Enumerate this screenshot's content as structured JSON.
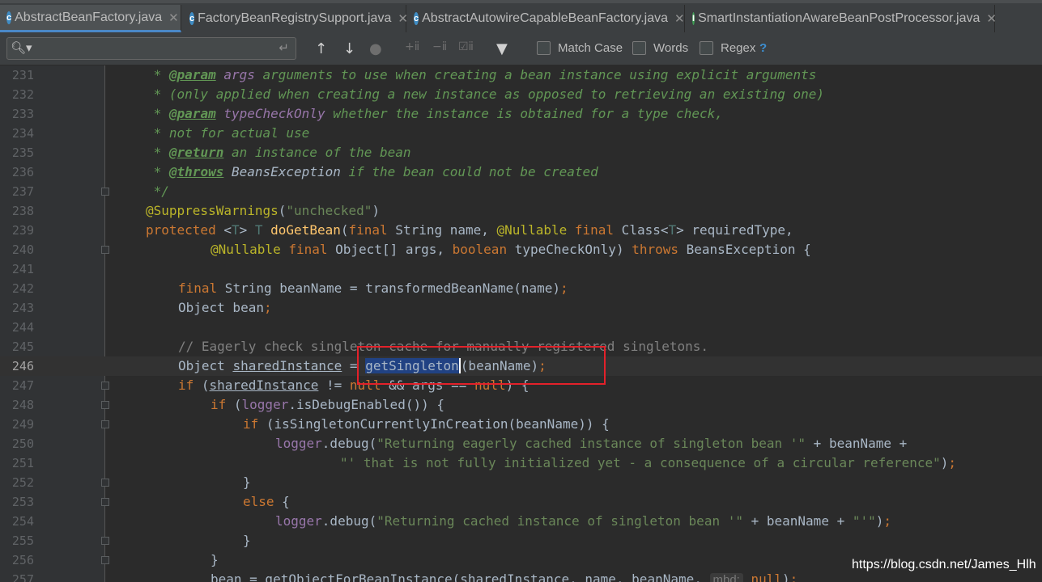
{
  "tabs": [
    {
      "label": "AbstractBeanFactory.java",
      "active": true,
      "icon": "java-class-icon",
      "icon_glyph": "c"
    },
    {
      "label": "FactoryBeanRegistrySupport.java",
      "active": false,
      "icon": "java-class-icon",
      "icon_glyph": "c"
    },
    {
      "label": "AbstractAutowireCapableBeanFactory.java",
      "active": false,
      "icon": "java-class-icon",
      "icon_glyph": "c"
    },
    {
      "label": "SmartInstantiationAwareBeanPostProcessor.java",
      "active": false,
      "icon": "java-interface-icon",
      "icon_glyph": "I"
    }
  ],
  "search": {
    "value": "",
    "options": {
      "match_case": "Match Case",
      "words": "Words",
      "regex": "Regex"
    },
    "help": "?"
  },
  "code_lines": [
    {
      "n": "231",
      "fold": false
    },
    {
      "n": "232",
      "fold": false
    },
    {
      "n": "233",
      "fold": false
    },
    {
      "n": "234",
      "fold": false
    },
    {
      "n": "235",
      "fold": false
    },
    {
      "n": "236",
      "fold": false
    },
    {
      "n": "237",
      "fold": true
    },
    {
      "n": "238",
      "fold": false
    },
    {
      "n": "239",
      "fold": false
    },
    {
      "n": "240",
      "fold": true
    },
    {
      "n": "241",
      "fold": false
    },
    {
      "n": "242",
      "fold": false
    },
    {
      "n": "243",
      "fold": false
    },
    {
      "n": "244",
      "fold": false
    },
    {
      "n": "245",
      "fold": false
    },
    {
      "n": "246",
      "fold": false,
      "current": true
    },
    {
      "n": "247",
      "fold": true
    },
    {
      "n": "248",
      "fold": true
    },
    {
      "n": "249",
      "fold": true
    },
    {
      "n": "250",
      "fold": false
    },
    {
      "n": "251",
      "fold": false
    },
    {
      "n": "252",
      "fold": true
    },
    {
      "n": "253",
      "fold": true
    },
    {
      "n": "254",
      "fold": false
    },
    {
      "n": "255",
      "fold": true
    },
    {
      "n": "256",
      "fold": true
    },
    {
      "n": "257",
      "fold": false
    }
  ],
  "code": {
    "l231": {
      "star": " * ",
      "tag": "@param",
      "name": "args",
      "text": " arguments to use when creating a bean instance using explicit arguments"
    },
    "l232": {
      "text": " * (only applied when creating a new instance as opposed to retrieving an existing one)"
    },
    "l233": {
      "star": " * ",
      "tag": "@param",
      "name": "typeCheckOnly",
      "text": " whether the instance is obtained for a type check,"
    },
    "l234": {
      "text": " * not for actual use"
    },
    "l235": {
      "star": " * ",
      "tag": "@return",
      "text": " an instance of the bean"
    },
    "l236": {
      "star": " * ",
      "tag": "@throws",
      "type": "BeansException",
      "text": " if the bean could not be created"
    },
    "l237": {
      "text": " */"
    },
    "l238": {
      "annotation": "@SuppressWarnings",
      "p1": "(",
      "str": "\"unchecked\"",
      "p2": ")"
    },
    "l239": {
      "kw1": "protected",
      "t1": " <",
      "tv1": "T",
      "t2": "> ",
      "tv2": "T",
      "t3": " ",
      "fn": "doGetBean",
      "t4": "(",
      "kw2": "final",
      "t5": " String name, ",
      "an": "@Nullable",
      "t6": " ",
      "kw3": "final",
      "t7": " Class<",
      "tv3": "T",
      "t8": "> requiredType,"
    },
    "l240": {
      "an": "@Nullable",
      "t1": " ",
      "kw1": "final",
      "t2": " Object[] args, ",
      "kw2": "boolean",
      "t3": " typeCheckOnly) ",
      "kw3": "throws",
      "t4": " BeansException {"
    },
    "l242": {
      "kw": "final",
      "t1": " String beanName = transformedBeanName(name)",
      "semi": ";"
    },
    "l243": {
      "t1": "Object bean",
      "semi": ";"
    },
    "l245": {
      "comment": "// Eagerly check singleton cache for manually registered singletons."
    },
    "l246": {
      "t1": "Object ",
      "var": "sharedInstance",
      "t2": " = ",
      "sel": "getSingleton",
      "t3": "(beanName)",
      "semi": ";"
    },
    "l247": {
      "kw": "if",
      "t1": " (",
      "var": "sharedInstance",
      "t2": " != ",
      "kw2": "null",
      "t3": " && args == ",
      "kw3": "null",
      "t4": ") {"
    },
    "l248": {
      "kw": "if",
      "t1": " (",
      "field": "logger",
      "t2": ".isDebugEnabled()) {"
    },
    "l249": {
      "kw": "if",
      "t1": " (isSingletonCurrentlyInCreation(beanName)) {"
    },
    "l250": {
      "field": "logger",
      "t1": ".debug(",
      "str": "\"Returning eagerly cached instance of singleton bean '\"",
      "t2": " + beanName +"
    },
    "l251": {
      "str": "\"' that is not fully initialized yet - a consequence of a circular reference\"",
      "t1": ")",
      "semi": ";"
    },
    "l252": {
      "t1": "}"
    },
    "l253": {
      "kw": "else",
      "t1": " {"
    },
    "l254": {
      "field": "logger",
      "t1": ".debug(",
      "str": "\"Returning cached instance of singleton bean '\"",
      "t2": " + beanName + ",
      "str2": "\"'\"",
      "t3": ")",
      "semi": ";"
    },
    "l255": {
      "t1": "}"
    },
    "l256": {
      "t1": "}"
    },
    "l257": {
      "t1": "bean = getObjectForBeanInstance(",
      "var": "sharedInstance",
      "t2": ", name, beanName, ",
      "hint": "mbd:",
      "kw": " null",
      "t3": ")",
      "semi": ";"
    }
  },
  "watermark": "https://blog.csdn.net/James_Hlh",
  "colors": {
    "keyword": "#cc7832",
    "string": "#6a8759",
    "comment": "#808080",
    "doc": "#629755",
    "annotation": "#bbb529",
    "highlight_box": "#e3212a",
    "selection": "#214283"
  }
}
